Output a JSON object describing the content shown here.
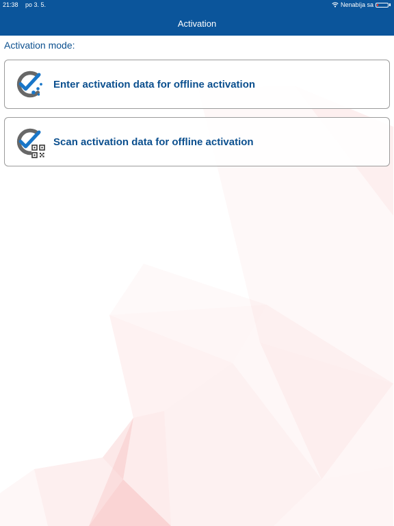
{
  "status_bar": {
    "time": "21:38",
    "date": "po 3. 5.",
    "charging_text": "Nenabíja sa",
    "wifi_icon": "wifi-icon",
    "battery_icon": "battery-icon"
  },
  "nav": {
    "title": "Activation"
  },
  "main": {
    "section_label": "Activation mode:",
    "options": [
      {
        "label": "Enter activation data for offline activation",
        "icon": "check-dots-icon"
      },
      {
        "label": "Scan activation data for offline activation",
        "icon": "check-qr-code-icon"
      }
    ]
  },
  "colors": {
    "header_background": "#0b559b",
    "label_text": "#0b4f8e",
    "border": "#9a9a9a",
    "icon_gray": "#686868",
    "icon_blue": "#1976c8",
    "decor_pink": "#f28c8c",
    "battery_low": "#ff3b30"
  }
}
